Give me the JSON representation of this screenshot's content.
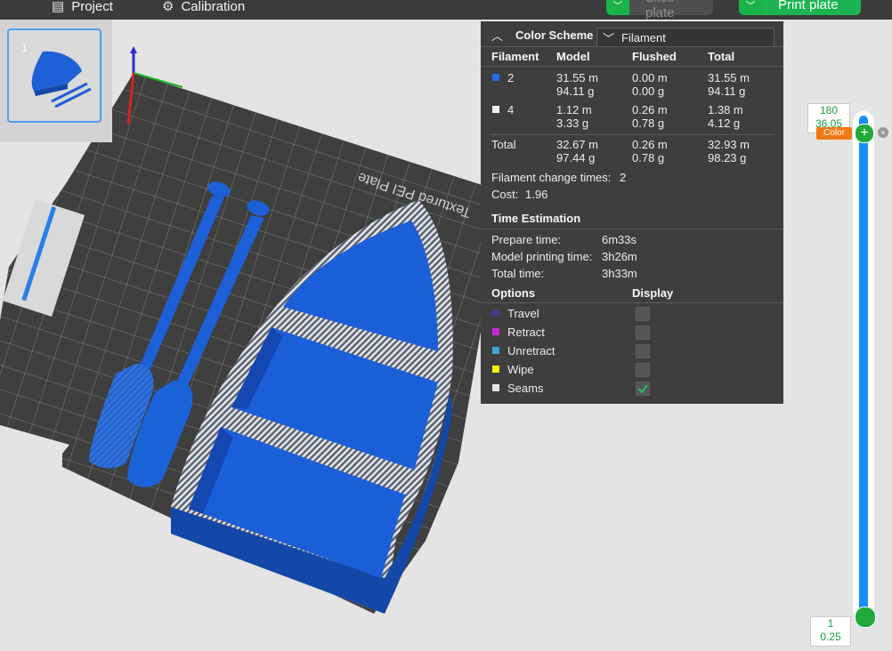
{
  "toolbar": {
    "project_label": "Project",
    "calibration_label": "Calibration",
    "slice_label": "Slice plate",
    "print_label": "Print plate"
  },
  "plate_thumb": {
    "index": "1"
  },
  "bed_label": "Textured PEI Plate",
  "scheme": {
    "title": "Color Scheme",
    "mode": "Filament",
    "headers": {
      "filament": "Filament",
      "model": "Model",
      "flushed": "Flushed",
      "total": "Total"
    },
    "rows": [
      {
        "id": "2",
        "color": "#1e6fe0",
        "model_m": "31.55 m",
        "model_g": "94.11 g",
        "flushed_m": "0.00 m",
        "flushed_g": "0.00 g",
        "total_m": "31.55 m",
        "total_g": "94.11 g"
      },
      {
        "id": "4",
        "color": "#f2f2f2",
        "model_m": "1.12 m",
        "model_g": "3.33 g",
        "flushed_m": "0.26 m",
        "flushed_g": "0.78 g",
        "total_m": "1.38 m",
        "total_g": "4.12 g"
      }
    ],
    "totals": {
      "label": "Total",
      "model_m": "32.67 m",
      "model_g": "97.44 g",
      "flushed_m": "0.26 m",
      "flushed_g": "0.78 g",
      "total_m": "32.93 m",
      "total_g": "98.23 g"
    },
    "change_times_label": "Filament change times:",
    "change_times": "2",
    "cost_label": "Cost:",
    "cost": "1.96"
  },
  "time": {
    "title": "Time Estimation",
    "prepare_label": "Prepare time:",
    "prepare": "6m33s",
    "model_label": "Model printing time:",
    "model": "3h26m",
    "total_label": "Total time:",
    "total": "3h33m"
  },
  "options": {
    "title": "Options",
    "display_title": "Display",
    "items": [
      {
        "label": "Travel",
        "color": "#3b3b8f",
        "checked": false
      },
      {
        "label": "Retract",
        "color": "#c42bd6",
        "checked": false
      },
      {
        "label": "Unretract",
        "color": "#3aa6d6",
        "checked": false
      },
      {
        "label": "Wipe",
        "color": "#f5f10a",
        "checked": false
      },
      {
        "label": "Seams",
        "color": "#e6e6e6",
        "checked": true
      }
    ]
  },
  "slider": {
    "top_layer": "180",
    "top_height": "36.05",
    "color_tag": "Color",
    "bottom_layer": "1",
    "bottom_height": "0.25"
  }
}
